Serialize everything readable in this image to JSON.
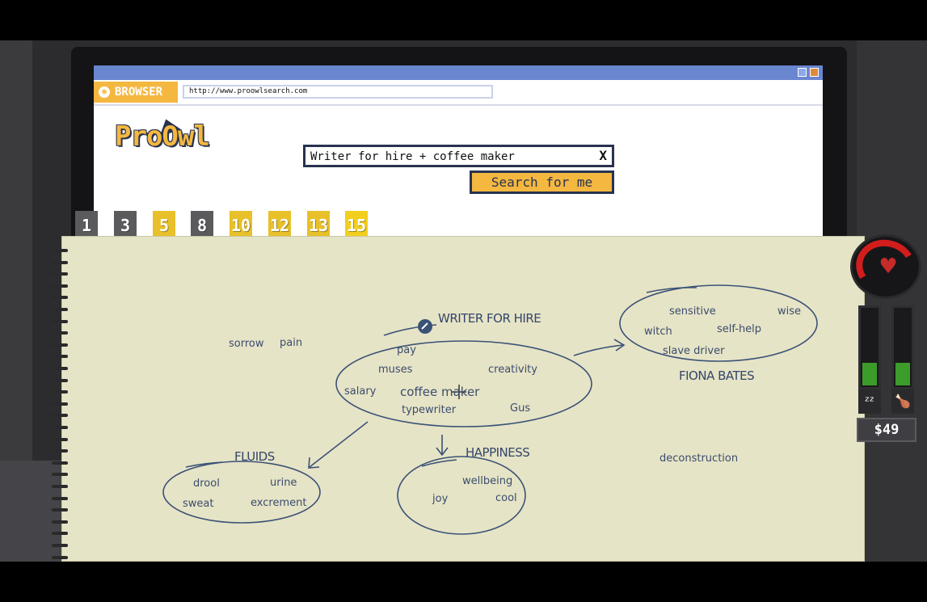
{
  "browser": {
    "tab_label": "BROWSER",
    "url": "http://www.proowlsearch.com",
    "logo_text": "ProOwl",
    "search_query": "Writer for hire + coffee maker",
    "clear_label": "X",
    "search_button": "Search for me"
  },
  "tabs": [
    {
      "label": "1",
      "color": "gray"
    },
    {
      "label": "3",
      "color": "gray"
    },
    {
      "label": "5",
      "color": "yellow"
    },
    {
      "label": "8",
      "color": "gray"
    },
    {
      "label": "10",
      "color": "yellow"
    },
    {
      "label": "12",
      "color": "yellow"
    },
    {
      "label": "13",
      "color": "yellow"
    },
    {
      "label": "15",
      "color": "yellow",
      "active": true
    }
  ],
  "mindmap": {
    "center": {
      "title": "WRITER FOR HIRE",
      "words": [
        "pay",
        "muses",
        "creativity",
        "salary",
        "coffee maker",
        "typewriter",
        "Gus"
      ]
    },
    "fiona": {
      "title": "FIONA BATES",
      "words": [
        "sensitive",
        "wise",
        "witch",
        "self-help",
        "slave driver"
      ]
    },
    "fluids": {
      "title": "FLUIDS",
      "words": [
        "drool",
        "urine",
        "sweat",
        "excrement"
      ]
    },
    "happiness": {
      "title": "HAPPINESS",
      "words": [
        "wellbeing",
        "joy",
        "cool"
      ]
    },
    "loose": [
      "sorrow",
      "pain",
      "deconstruction"
    ]
  },
  "hud": {
    "money": "$49",
    "health": 0.3,
    "sleep_level": 0.3,
    "food_level": 0.3,
    "sleep_icon": "zzz-icon",
    "food_icon": "drumstick-icon"
  },
  "colors": {
    "accent": "#f4b740",
    "ink": "#34466b",
    "paper": "#e6e4c6",
    "titlebar": "#6a86cf",
    "meter": "#3c9c2a",
    "heart": "#d21d1d"
  }
}
